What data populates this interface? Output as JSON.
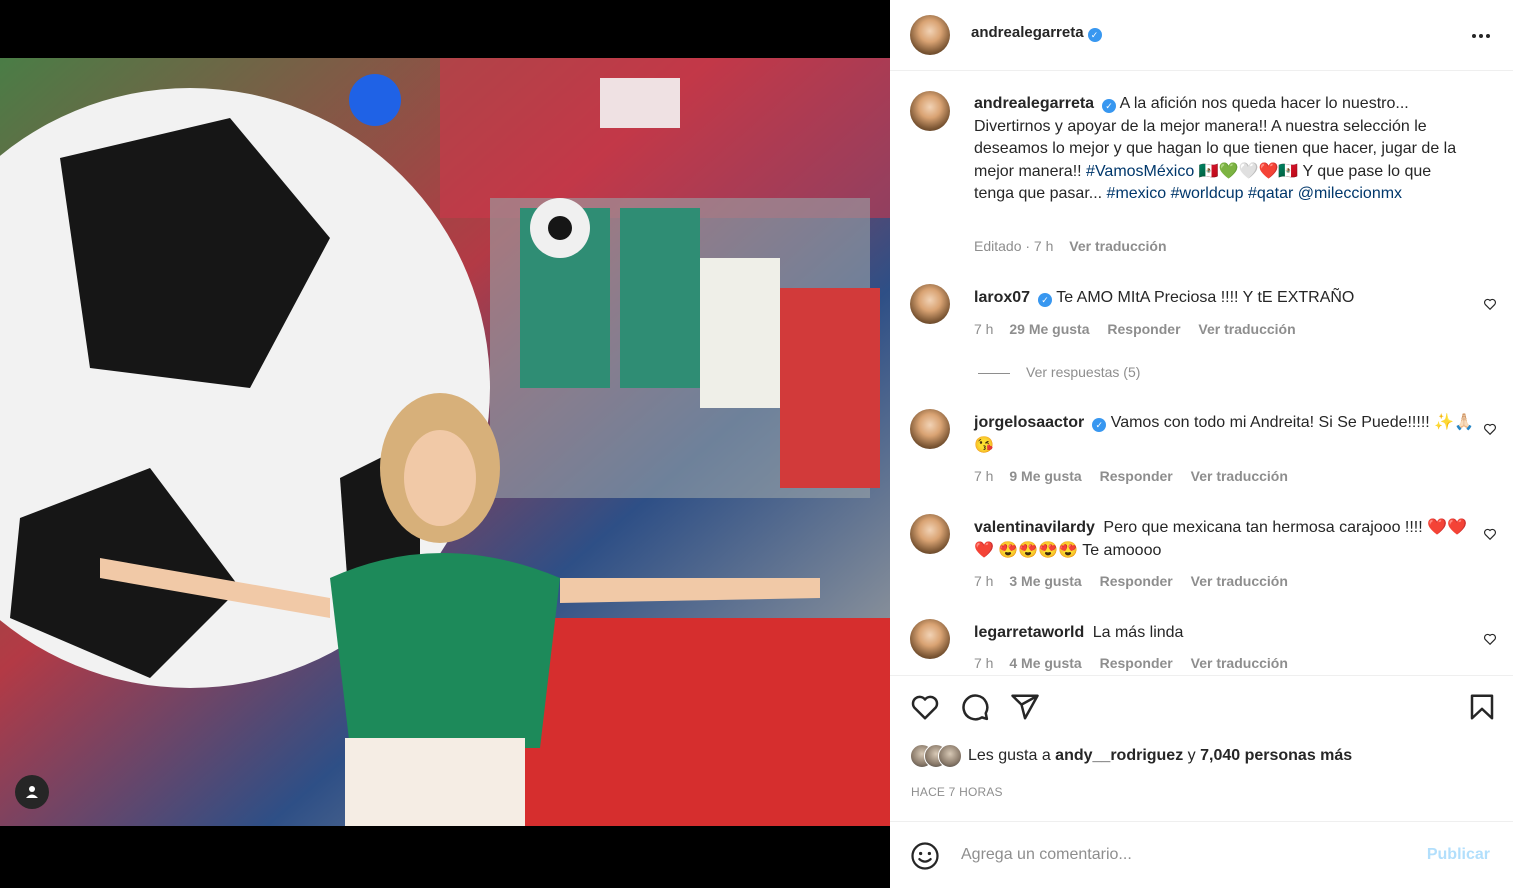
{
  "post": {
    "author": "andrealegarreta",
    "caption_parts": {
      "text1": "A la afición nos queda hacer lo nuestro... Divertirnos y apoyar de la mejor manera!! A nuestra selección le deseamos lo mejor y que hagan lo que tienen que hacer, jugar de la mejor manera!! ",
      "tag1": "#VamosMéxico",
      "emojis1": " 🇲🇽💚🤍❤️🇲🇽 ",
      "text2": "Y que pase lo que tenga que pasar... ",
      "tag2": "#mexico",
      "tag3": "#worldcup",
      "tag4": "#qatar",
      "mention": "@mileccionmx"
    },
    "caption_meta_edited": "Editado · 7 h",
    "caption_meta_translate": "Ver traducción"
  },
  "comments": [
    {
      "user": "larox07",
      "verified": true,
      "text": "Te AMO MItA Preciosa !!!! Y tE EXTRAÑO",
      "time": "7 h",
      "likes": "29 Me gusta",
      "reply": "Responder",
      "translate": "Ver traducción"
    },
    {
      "user": "jorgelosaactor",
      "verified": true,
      "text": "Vamos con todo mi Andreita! Si Se Puede!!!!! ✨🙏🏻😘",
      "time": "7 h",
      "likes": "9 Me gusta",
      "reply": "Responder",
      "translate": "Ver traducción"
    },
    {
      "user": "valentinavilardy",
      "verified": false,
      "text": "Pero que mexicana tan hermosa carajooo !!!! ❤️❤️❤️ 😍😍😍😍 Te amoooo",
      "time": "7 h",
      "likes": "3 Me gusta",
      "reply": "Responder",
      "translate": "Ver traducción"
    },
    {
      "user": "legarretaworld",
      "verified": false,
      "text": "La más linda",
      "time": "7 h",
      "likes": "4 Me gusta",
      "reply": "Responder",
      "translate": "Ver traducción"
    }
  ],
  "view_replies": "Ver respuestas (5)",
  "likes": {
    "prefix": "Les gusta a ",
    "user": "andy__rodriguez",
    "mid": " y ",
    "count": "7,040 personas más"
  },
  "time_ago": "HACE 7 HORAS",
  "add_comment_placeholder": "Agrega un comentario...",
  "publish_label": "Publicar",
  "colors": {
    "link": "#00376b",
    "verified": "#3897f0",
    "publish": "#b2dffc",
    "muted": "#8e8e8e"
  },
  "icons": [
    "more-icon",
    "heart-icon",
    "comment-icon",
    "share-icon",
    "bookmark-icon",
    "emoji-icon",
    "user-tag-icon"
  ]
}
